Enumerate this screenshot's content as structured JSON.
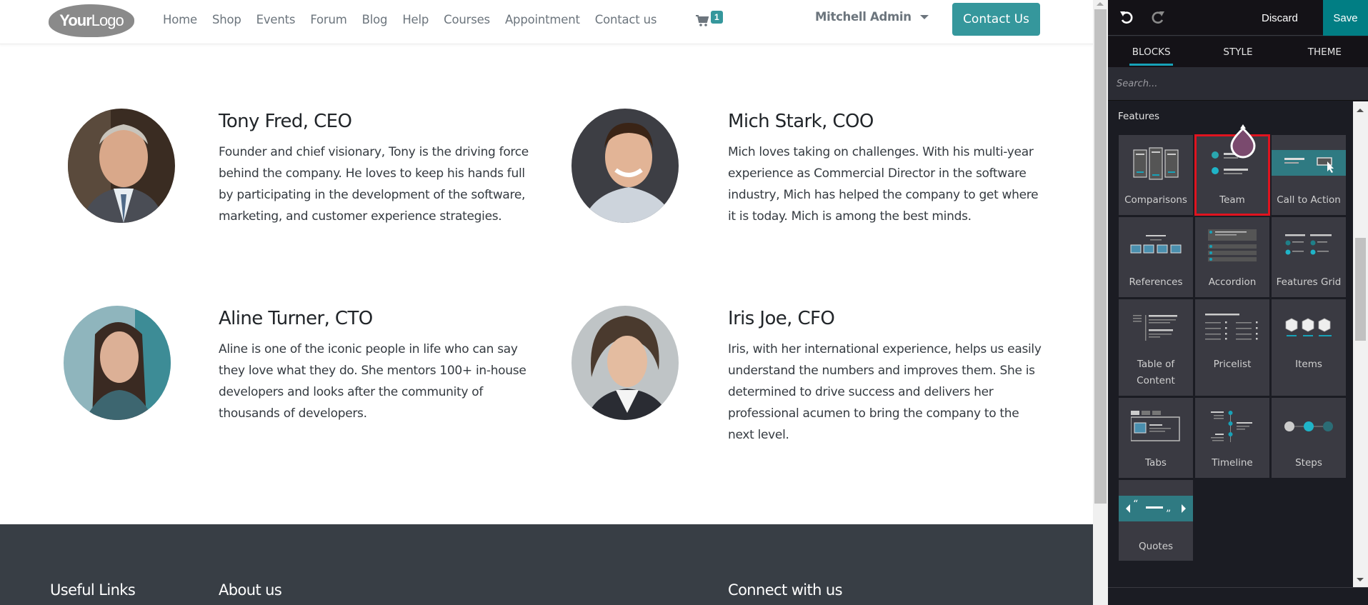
{
  "site": {
    "logo": {
      "bold": "Your",
      "light": "Logo"
    },
    "nav": [
      "Home",
      "Shop",
      "Events",
      "Forum",
      "Blog",
      "Help",
      "Courses",
      "Appointment",
      "Contact us"
    ],
    "cart_count": "1",
    "user_name": "Mitchell Admin",
    "contact_button": "Contact Us",
    "accent_color": "#35979c",
    "team": [
      {
        "name": "Tony Fred, CEO",
        "bio": "Founder and chief visionary, Tony is the driving force behind the company. He loves to keep his hands full by participating in the development of the software, marketing, and customer experience strategies."
      },
      {
        "name": "Mich Stark, COO",
        "bio": "Mich loves taking on challenges. With his multi-year experience as Commercial Director in the software industry, Mich has helped the company to get where it is today. Mich is among the best minds."
      },
      {
        "name": "Aline Turner, CTO",
        "bio": "Aline is one of the iconic people in life who can say they love what they do. She mentors 100+ in-house developers and looks after the community of thousands of developers."
      },
      {
        "name": "Iris Joe, CFO",
        "bio": "Iris, with her international experience, helps us easily understand the numbers and improves them. She is determined to drive success and delivers her professional acumen to bring the company to the next level."
      }
    ],
    "footer": {
      "useful_links": "Useful Links",
      "about_us": "About us",
      "connect": "Connect with us"
    }
  },
  "editor": {
    "discard": "Discard",
    "save": "Save",
    "tabs": [
      "BLOCKS",
      "STYLE",
      "THEME"
    ],
    "active_tab": "BLOCKS",
    "search_placeholder": "Search...",
    "category": "Features",
    "blocks": [
      "Comparisons",
      "Team",
      "Call to Action",
      "References",
      "Accordion",
      "Features Grid",
      "Table of Content",
      "Pricelist",
      "Items",
      "Tabs",
      "Timeline",
      "Steps",
      "Quotes"
    ],
    "selected_block": "Team",
    "accent_color": "#017e84",
    "highlight_color": "#e0131f"
  }
}
